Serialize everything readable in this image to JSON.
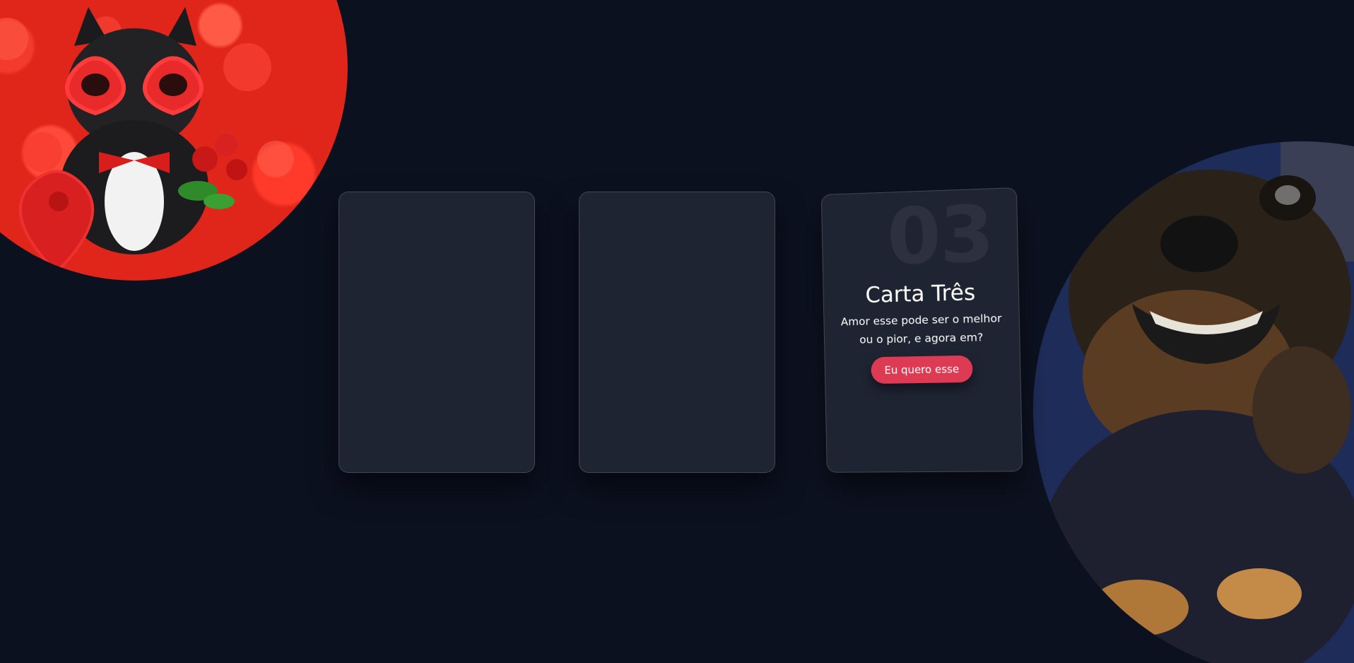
{
  "cards": [
    {
      "number": "",
      "title": "",
      "text": "",
      "button": ""
    },
    {
      "number": "",
      "title": "",
      "text": "",
      "button": ""
    },
    {
      "number": "03",
      "title": "Carta Três",
      "text": "Amor esse pode ser o melhor ou o pior, e agora em?",
      "button": "Eu quero esse"
    }
  ],
  "colors": {
    "background": "#0c1120",
    "card": "#1f2433",
    "accent_button": "#dd3a54"
  },
  "images": {
    "top_left": "french-bulldog-valentine-photo",
    "bottom_right": "smiling-dog-photo"
  }
}
